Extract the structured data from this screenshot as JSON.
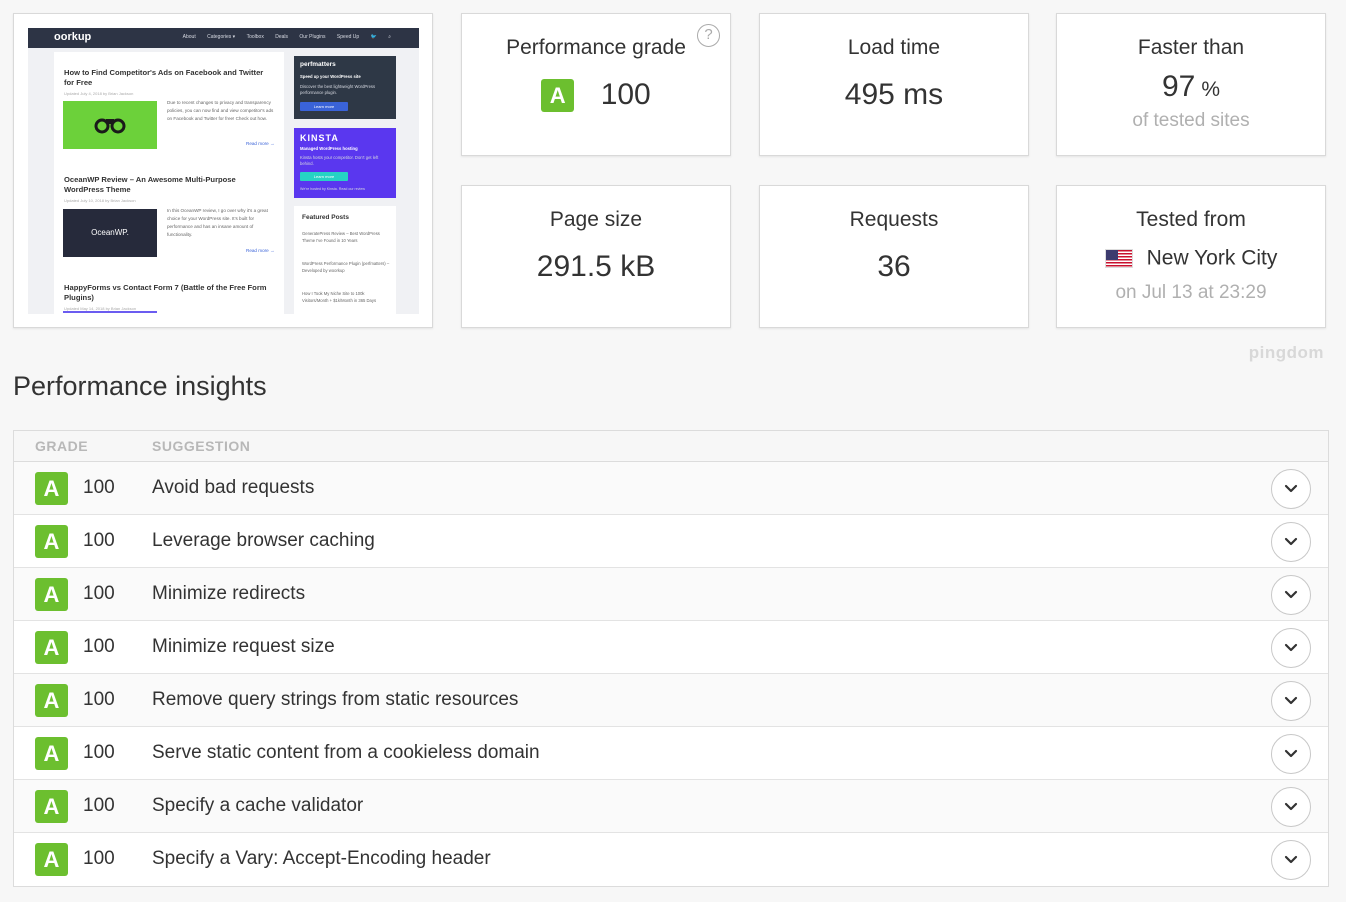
{
  "thumbnail": {
    "logo": "oorkup",
    "nav": [
      "About",
      "Categories ▾",
      "Toolbox",
      "Deals",
      "Our Plugins",
      "Speed Up"
    ],
    "posts": [
      {
        "title": "How to Find Competitor's Ads on Facebook and Twitter for Free",
        "meta": "Updated July 4, 2018 by Brian Jackson",
        "excerpt": "Due to recent changes to privacy and transparency policies, you can now find and view competitor's ads on Facebook and Twitter for free! Check out how.",
        "read_more": "Read more →"
      },
      {
        "title": "OceanWP Review – An Awesome Multi-Purpose WordPress Theme",
        "meta": "Updated July 10, 2018 by Brian Jackson",
        "image_text": "OceanWP.",
        "excerpt": "In this OceanWP review, I go over why it's a great choice for your WordPress site. It's built for performance and has an insane amount of functionality.",
        "read_more": "Read more →"
      },
      {
        "title": "HappyForms vs Contact Form 7 (Battle of the Free Form Plugins)",
        "meta": "Updated May 14, 2018 by Brian Jackson"
      }
    ],
    "sidebar": {
      "perfmatters": {
        "name": "perfmatters",
        "tagline": "Speed up your WordPress site",
        "text": "Discover the best lightweight WordPress performance plugin.",
        "button": "Learn more"
      },
      "kinsta": {
        "name": "KINSTA",
        "tagline": "Managed WordPress hosting",
        "text": "Kinsta hosts your competitor. Don't get left behind.",
        "button": "Learn more",
        "footer": "We're hosted by Kinsta. Read our review"
      },
      "featured": {
        "title": "Featured Posts",
        "items": [
          "GeneratePress Review – Best WordPress Theme I've Found in 10 Years",
          "WordPress Performance Plugin (perfmatters) – Developed by woorkup",
          "How I Took My Niche Site to 100k Visitors/Month + $1k/Month in 365 Days"
        ]
      }
    }
  },
  "metrics": {
    "performance_grade": {
      "label": "Performance grade",
      "grade": "A",
      "value": "100",
      "help_icon": "?"
    },
    "load_time": {
      "label": "Load time",
      "value": "495 ms"
    },
    "faster_than": {
      "label": "Faster than",
      "value": "97",
      "unit": "%",
      "sub": "of tested sites"
    },
    "page_size": {
      "label": "Page size",
      "value": "291.5 kB"
    },
    "requests": {
      "label": "Requests",
      "value": "36"
    },
    "tested_from": {
      "label": "Tested from",
      "location": "New York City",
      "flag": "us-flag-icon",
      "sub": "on Jul 13 at 23:29"
    }
  },
  "brand": "pingdom",
  "insights": {
    "title": "Performance insights",
    "columns": {
      "grade": "GRADE",
      "suggestion": "SUGGESTION"
    },
    "rows": [
      {
        "grade": "A",
        "score": "100",
        "suggestion": "Avoid bad requests"
      },
      {
        "grade": "A",
        "score": "100",
        "suggestion": "Leverage browser caching"
      },
      {
        "grade": "A",
        "score": "100",
        "suggestion": "Minimize redirects"
      },
      {
        "grade": "A",
        "score": "100",
        "suggestion": "Minimize request size"
      },
      {
        "grade": "A",
        "score": "100",
        "suggestion": "Remove query strings from static resources"
      },
      {
        "grade": "A",
        "score": "100",
        "suggestion": "Serve static content from a cookieless domain"
      },
      {
        "grade": "A",
        "score": "100",
        "suggestion": "Specify a cache validator"
      },
      {
        "grade": "A",
        "score": "100",
        "suggestion": "Specify a Vary: Accept-Encoding header"
      }
    ]
  },
  "colors": {
    "grade_a": "#6cbf2f",
    "background": "#f7f7f7",
    "site_nav": "#2d3445",
    "kinsta_purple": "#5a37ef"
  }
}
